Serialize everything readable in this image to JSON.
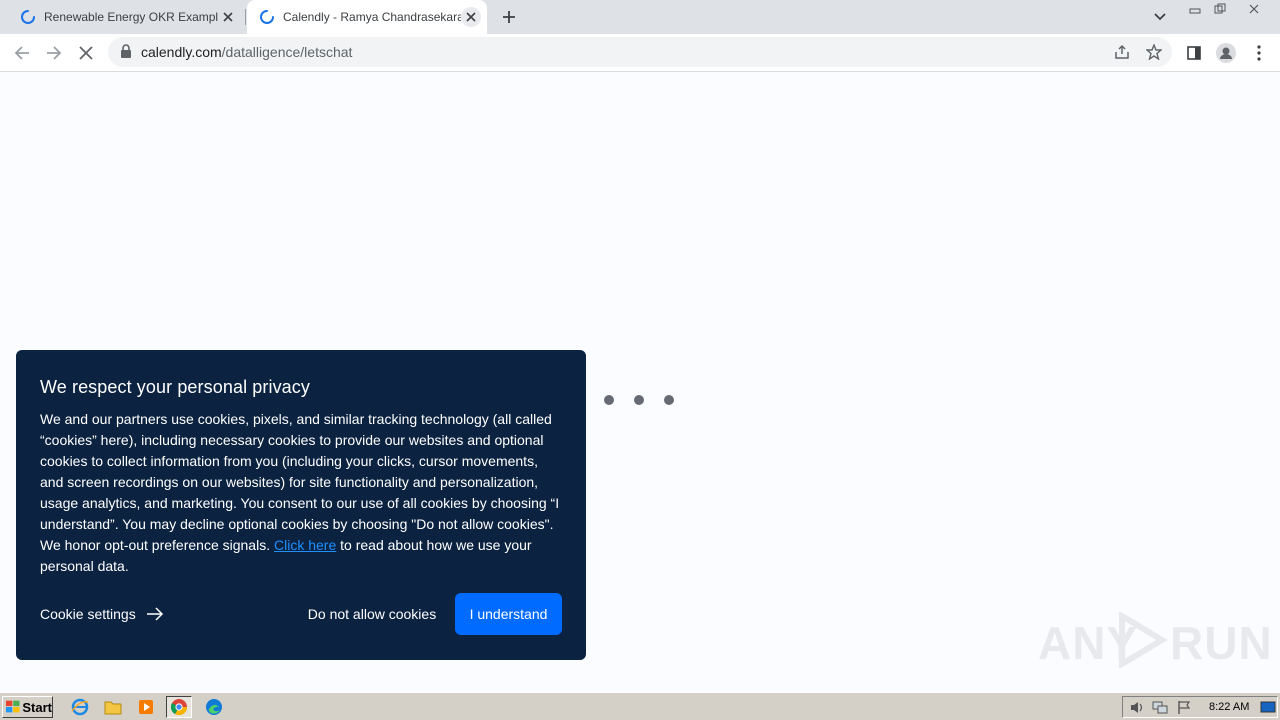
{
  "browser": {
    "tabs": [
      {
        "title": "Renewable Energy OKR Examples: D",
        "loading": true,
        "active": false
      },
      {
        "title": "Calendly - Ramya Chandrasekaran",
        "loading": true,
        "active": true
      }
    ],
    "url_host": "calendly.com",
    "url_path": "/datalligence/letschat",
    "icons": {
      "back": "arrow-left-icon",
      "forward": "arrow-right-icon",
      "stop": "close-icon",
      "share": "share-icon",
      "bookmark": "star-icon",
      "side_panel": "side-panel-icon",
      "profile": "profile-icon",
      "menu": "kebab-menu-icon"
    }
  },
  "cookie_banner": {
    "title": "We respect your personal privacy",
    "body": "We and our partners use cookies, pixels, and similar tracking technology (all called “cookies” here), including necessary cookies to provide our websites and optional cookies to collect information from you (including your clicks, cursor movements, and screen recordings on our websites) for site functionality and personalization, usage analytics, and marketing. You consent to our use of all cookies by choosing “I understand”. You may decline optional cookies by choosing \"Do not allow cookies\". We honor opt-out preference signals. ",
    "link_text": "Click here",
    "body_suffix": " to read about how we use your personal data.",
    "settings_label": "Cookie settings",
    "decline_label": "Do not allow cookies",
    "accept_label": "I understand",
    "colors": {
      "background": "#0b2240",
      "accent": "#006bff",
      "link": "#1e90ff"
    }
  },
  "watermark": {
    "left": "ANY",
    "right": "RUN"
  },
  "taskbar": {
    "start_label": "Start",
    "apps": [
      "ie-icon",
      "folder-icon",
      "media-player-icon",
      "chrome-icon",
      "edge-icon"
    ],
    "tray_icons": [
      "volume-icon",
      "network-icon",
      "flag-icon"
    ],
    "clock": "8:22 AM"
  }
}
